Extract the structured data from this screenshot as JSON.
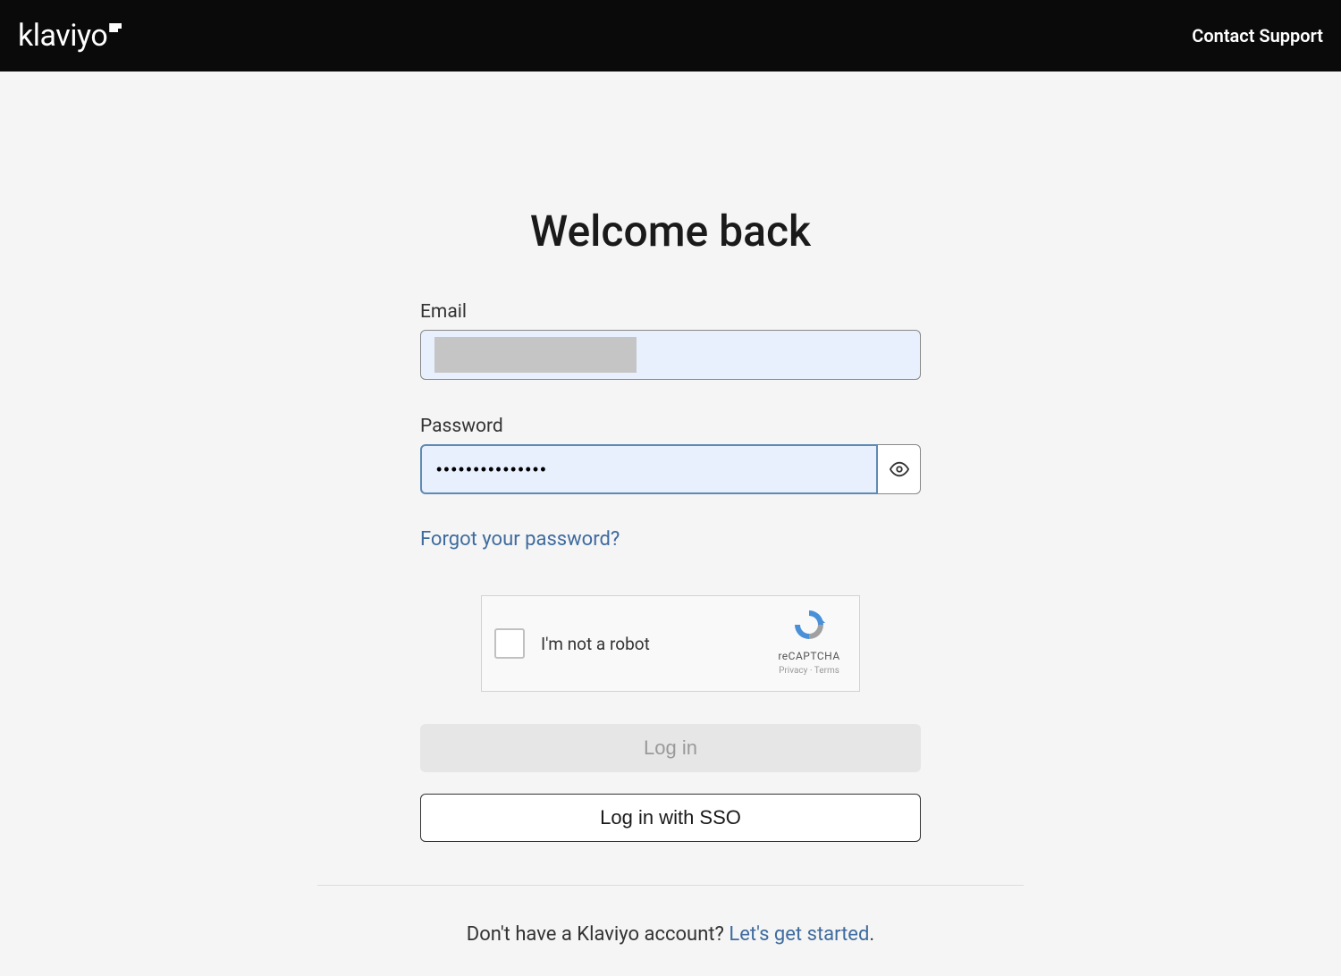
{
  "header": {
    "logo_text": "klaviyo",
    "contact_support": "Contact Support"
  },
  "login": {
    "title": "Welcome back",
    "email_label": "Email",
    "email_value": "",
    "password_label": "Password",
    "password_value": "•••••••••••••••",
    "forgot_link": "Forgot your password?",
    "login_button": "Log in",
    "sso_button": "Log in with SSO"
  },
  "recaptcha": {
    "text": "I'm not a robot",
    "brand": "reCAPTCHA",
    "links": "Privacy · Terms"
  },
  "signup": {
    "prompt": "Don't have a Klaviyo account? ",
    "link": "Let's get started",
    "suffix": "."
  }
}
